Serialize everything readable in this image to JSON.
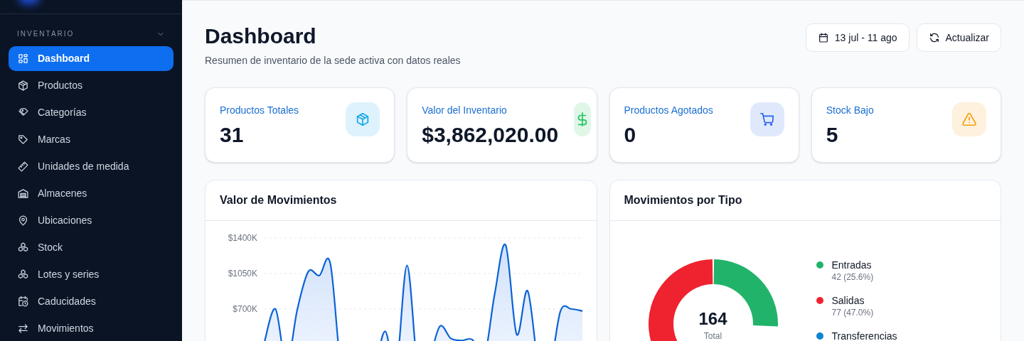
{
  "sidebar": {
    "section": {
      "label": "INVENTARIO",
      "expanded": true
    },
    "items": [
      {
        "label": "Dashboard",
        "selected": true
      },
      {
        "label": "Productos",
        "selected": false
      },
      {
        "label": "Categorías",
        "selected": false
      },
      {
        "label": "Marcas",
        "selected": false
      },
      {
        "label": "Unidades de medida",
        "selected": false
      },
      {
        "label": "Almacenes",
        "selected": false
      },
      {
        "label": "Ubicaciones",
        "selected": false
      },
      {
        "label": "Stock",
        "selected": false
      },
      {
        "label": "Lotes y series",
        "selected": false
      },
      {
        "label": "Caducidades",
        "selected": false
      },
      {
        "label": "Movimientos",
        "selected": false
      }
    ]
  },
  "header": {
    "title": "Dashboard",
    "subtitle": "Resumen de inventario de la sede activa con datos reales",
    "buttons": [
      {
        "label": "13 jul - 11 ago"
      },
      {
        "label": "Actualizar"
      }
    ]
  },
  "stats": [
    {
      "label": "Productos Totales",
      "value": "31",
      "color": "#0ea5e9"
    },
    {
      "label": "Valor del Inventario",
      "value": "$3,862,020.00",
      "color": "#22c55e"
    },
    {
      "label": "Productos Agotados",
      "value": "0",
      "color": "#2563eb"
    },
    {
      "label": "Stock Bajo",
      "value": "5",
      "color": "#f59e0b"
    }
  ],
  "movement_value": {
    "title": "Valor de Movimientos",
    "chart_data": {
      "type": "area",
      "ylim": [
        0,
        1400
      ],
      "yticks": [
        {
          "value": 700,
          "label": "$700K"
        },
        {
          "value": 1050,
          "label": "$1050K"
        },
        {
          "value": 1400,
          "label": "$1400K"
        }
      ],
      "values": [
        380,
        700,
        150,
        700,
        1070,
        1030,
        1150,
        100,
        0,
        0,
        100,
        480,
        100,
        1130,
        100,
        200,
        530,
        410,
        390,
        395,
        200,
        850,
        1330,
        450,
        880,
        150,
        100,
        680,
        700,
        680
      ]
    }
  },
  "movement_types": {
    "title": "Movimientos por Tipo",
    "total": "164",
    "total_label": "Total",
    "legend": [
      {
        "label": "Entradas",
        "detail": "42 (25.6%)",
        "color": "#22b36b"
      },
      {
        "label": "Salidas",
        "detail": "77 (47.0%)",
        "color": "#ef2330"
      },
      {
        "label": "Transferencias",
        "color": "#0a84d0"
      }
    ]
  }
}
